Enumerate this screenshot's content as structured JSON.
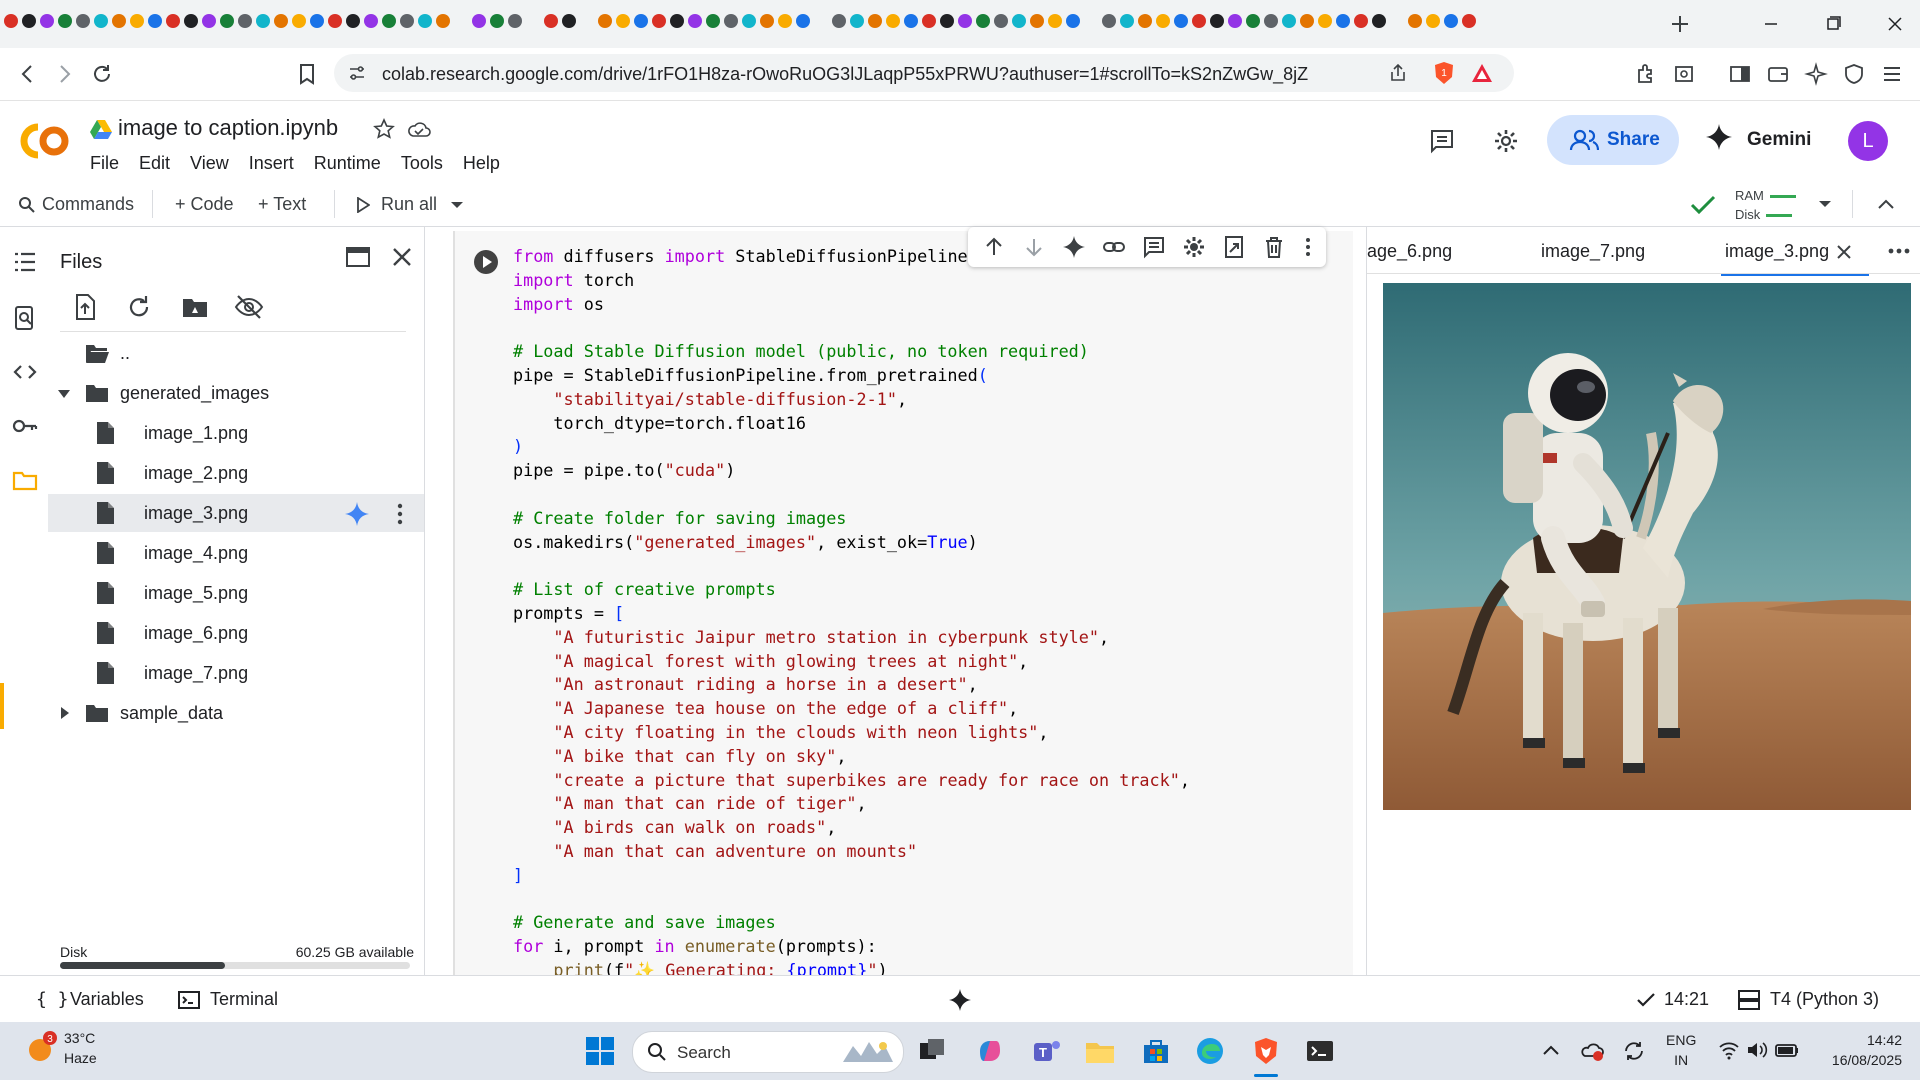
{
  "browser": {
    "url": "colab.research.google.com/drive/1rFO1H8za-rOwoRuOG3lJLaqpP55xPRWU?authuser=1#scrollTo=kS2nZwGw_8jZ",
    "brave_badge": "1"
  },
  "colab": {
    "logo_text": "CO",
    "title": "image to caption.ipynb",
    "menu": [
      "File",
      "Edit",
      "View",
      "Insert",
      "Runtime",
      "Tools",
      "Help"
    ],
    "share_label": "Share",
    "gemini_label": "Gemini",
    "avatar_letter": "L"
  },
  "toolbar": {
    "commands": "Commands",
    "code": "+ Code",
    "text": "+ Text",
    "run_all": "Run all",
    "ram_label": "RAM",
    "disk_label": "Disk"
  },
  "files_panel": {
    "title": "Files",
    "parent": "..",
    "folder": "generated_images",
    "items": [
      "image_1.png",
      "image_2.png",
      "image_3.png",
      "image_4.png",
      "image_5.png",
      "image_6.png",
      "image_7.png"
    ],
    "selected_index": 2,
    "other_folder": "sample_data",
    "disk_label": "Disk",
    "disk_available": "60.25 GB available",
    "disk_used_fraction": 0.47
  },
  "viewer": {
    "tabs": [
      "age_6.png",
      "image_7.png",
      "image_3.png"
    ],
    "active_tab": "image_3.png"
  },
  "statusbar": {
    "variables": "Variables",
    "terminal": "Terminal",
    "time": "14:21",
    "runtime": "T4 (Python 3)"
  },
  "taskbar": {
    "weather_badge": "3",
    "temp": "33°C",
    "condition": "Haze",
    "search": "Search",
    "lang1": "ENG",
    "lang2": "IN",
    "clock_time": "14:42",
    "clock_date": "16/08/2025"
  },
  "colors": {
    "accent": "#1a73e8",
    "share_bg": "#d3e3fd",
    "colab_orange": "#f9ab00",
    "avatar": "#9334e6"
  }
}
